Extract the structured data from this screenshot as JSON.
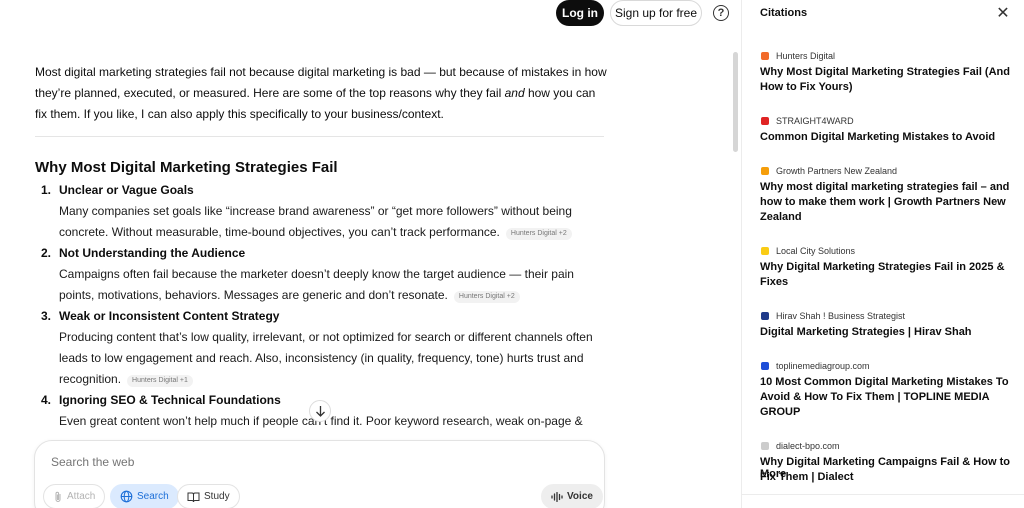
{
  "header": {
    "login_label": "Log in",
    "signup_label": "Sign up for free",
    "help_icon": "question-circle-icon"
  },
  "main": {
    "intro_part1": "Most digital marketing strategies fail not because digital marketing is bad — but because of mistakes in how they’re planned, executed, or measured. Here are some of the top reasons why they fail ",
    "intro_em": "and",
    "intro_part2": " how you can fix them. If you like, I can also apply this specifically to your business/context.",
    "section_title": "Why Most Digital Marketing Strategies Fail",
    "reasons": [
      {
        "num": "1.",
        "title": "Unclear or Vague Goals",
        "body": "Many companies set goals like “increase brand awareness” or “get more followers” without being concrete. Without measurable, time-bound objectives, you can’t track performance.",
        "citation": "Hunters Digital +2"
      },
      {
        "num": "2.",
        "title": "Not Understanding the Audience",
        "body": "Campaigns often fail because the marketer doesn’t deeply know the target audience — their pain points, motivations, behaviors. Messages are generic and don’t resonate.",
        "citation": "Hunters Digital +2"
      },
      {
        "num": "3.",
        "title": "Weak or Inconsistent Content Strategy",
        "body": "Producing content that’s low quality, irrelevant, or not optimized for search or different channels often leads to low engagement and reach. Also, inconsistency (in quality, frequency, tone) hurts trust and recognition.",
        "citation": "Hunters Digital +1"
      },
      {
        "num": "4.",
        "title": "Ignoring SEO & Technical Foundations",
        "body": "Even great content won’t help much if people can’t find it. Poor keyword research, weak on-page &",
        "citation": ""
      }
    ]
  },
  "composer": {
    "placeholder": "Search the web",
    "attach_label": "Attach",
    "search_label": "Search",
    "study_label": "Study",
    "voice_label": "Voice"
  },
  "citations": {
    "title": "Citations",
    "more_label": "More",
    "items": [
      {
        "source": "Hunters Digital",
        "title": "Why Most Digital Marketing Strategies Fail (And How to Fix Yours)",
        "favicon_color": "#f26b2a",
        "favicon": "hunters-digital-icon"
      },
      {
        "source": "STRAIGHT4WARD",
        "title": "Common Digital Marketing Mistakes to Avoid",
        "favicon_color": "#e02424",
        "favicon": "straight4ward-icon"
      },
      {
        "source": "Growth Partners New Zealand",
        "title": "Why most digital marketing strategies fail – and how to make them work | Growth Partners New Zealand",
        "favicon_color": "#f59e0b",
        "favicon": "growth-partners-icon"
      },
      {
        "source": "Local City Solutions",
        "title": "Why Digital Marketing Strategies Fail in 2025 & Fixes",
        "favicon_color": "#facc15",
        "favicon": "bulb-icon"
      },
      {
        "source": "Hirav Shah ! Business Strategist",
        "title": "Digital Marketing Strategies | Hirav Shah",
        "favicon_color": "#1e3a8a",
        "favicon": "hirav-shah-icon"
      },
      {
        "source": "toplinemediagroup.com",
        "title": "10 Most Common Digital Marketing Mistakes To Avoid & How To Fix Them | TOPLINE MEDIA GROUP",
        "favicon_color": "#1d4ed8",
        "favicon": "topline-icon"
      },
      {
        "source": "dialect-bpo.com",
        "title": "Why Digital Marketing Campaigns Fail & How to Fix Them | Dialect",
        "favicon_color": "#cccccc",
        "favicon": "globe-icon"
      }
    ]
  }
}
